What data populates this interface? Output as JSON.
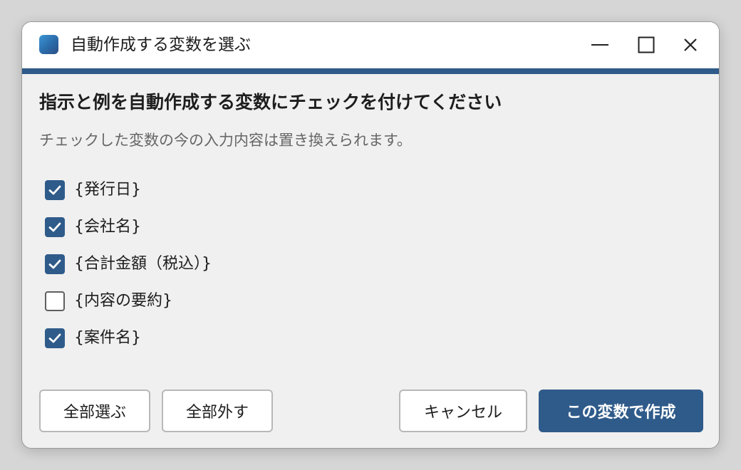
{
  "window": {
    "title": "自動作成する変数を選ぶ",
    "accent_color": "#2f5b8a",
    "icon": "app-icon"
  },
  "window_controls": {
    "minimize_icon": "minimize-icon",
    "maximize_icon": "maximize-icon",
    "close_icon": "close-icon"
  },
  "content": {
    "heading": "指示と例を自動作成する変数にチェックを付けてください",
    "subtext": "チェックした変数の今の入力内容は置き換えられます。"
  },
  "variables": [
    {
      "label": "{発行日}",
      "checked": true
    },
    {
      "label": "{会社名}",
      "checked": true
    },
    {
      "label": "{合計金額（税込）}",
      "checked": true
    },
    {
      "label": "{内容の要約}",
      "checked": false
    },
    {
      "label": "{案件名}",
      "checked": true
    }
  ],
  "buttons": {
    "select_all": "全部選ぶ",
    "clear_all": "全部外す",
    "cancel": "キャンセル",
    "create": "この変数で作成"
  }
}
